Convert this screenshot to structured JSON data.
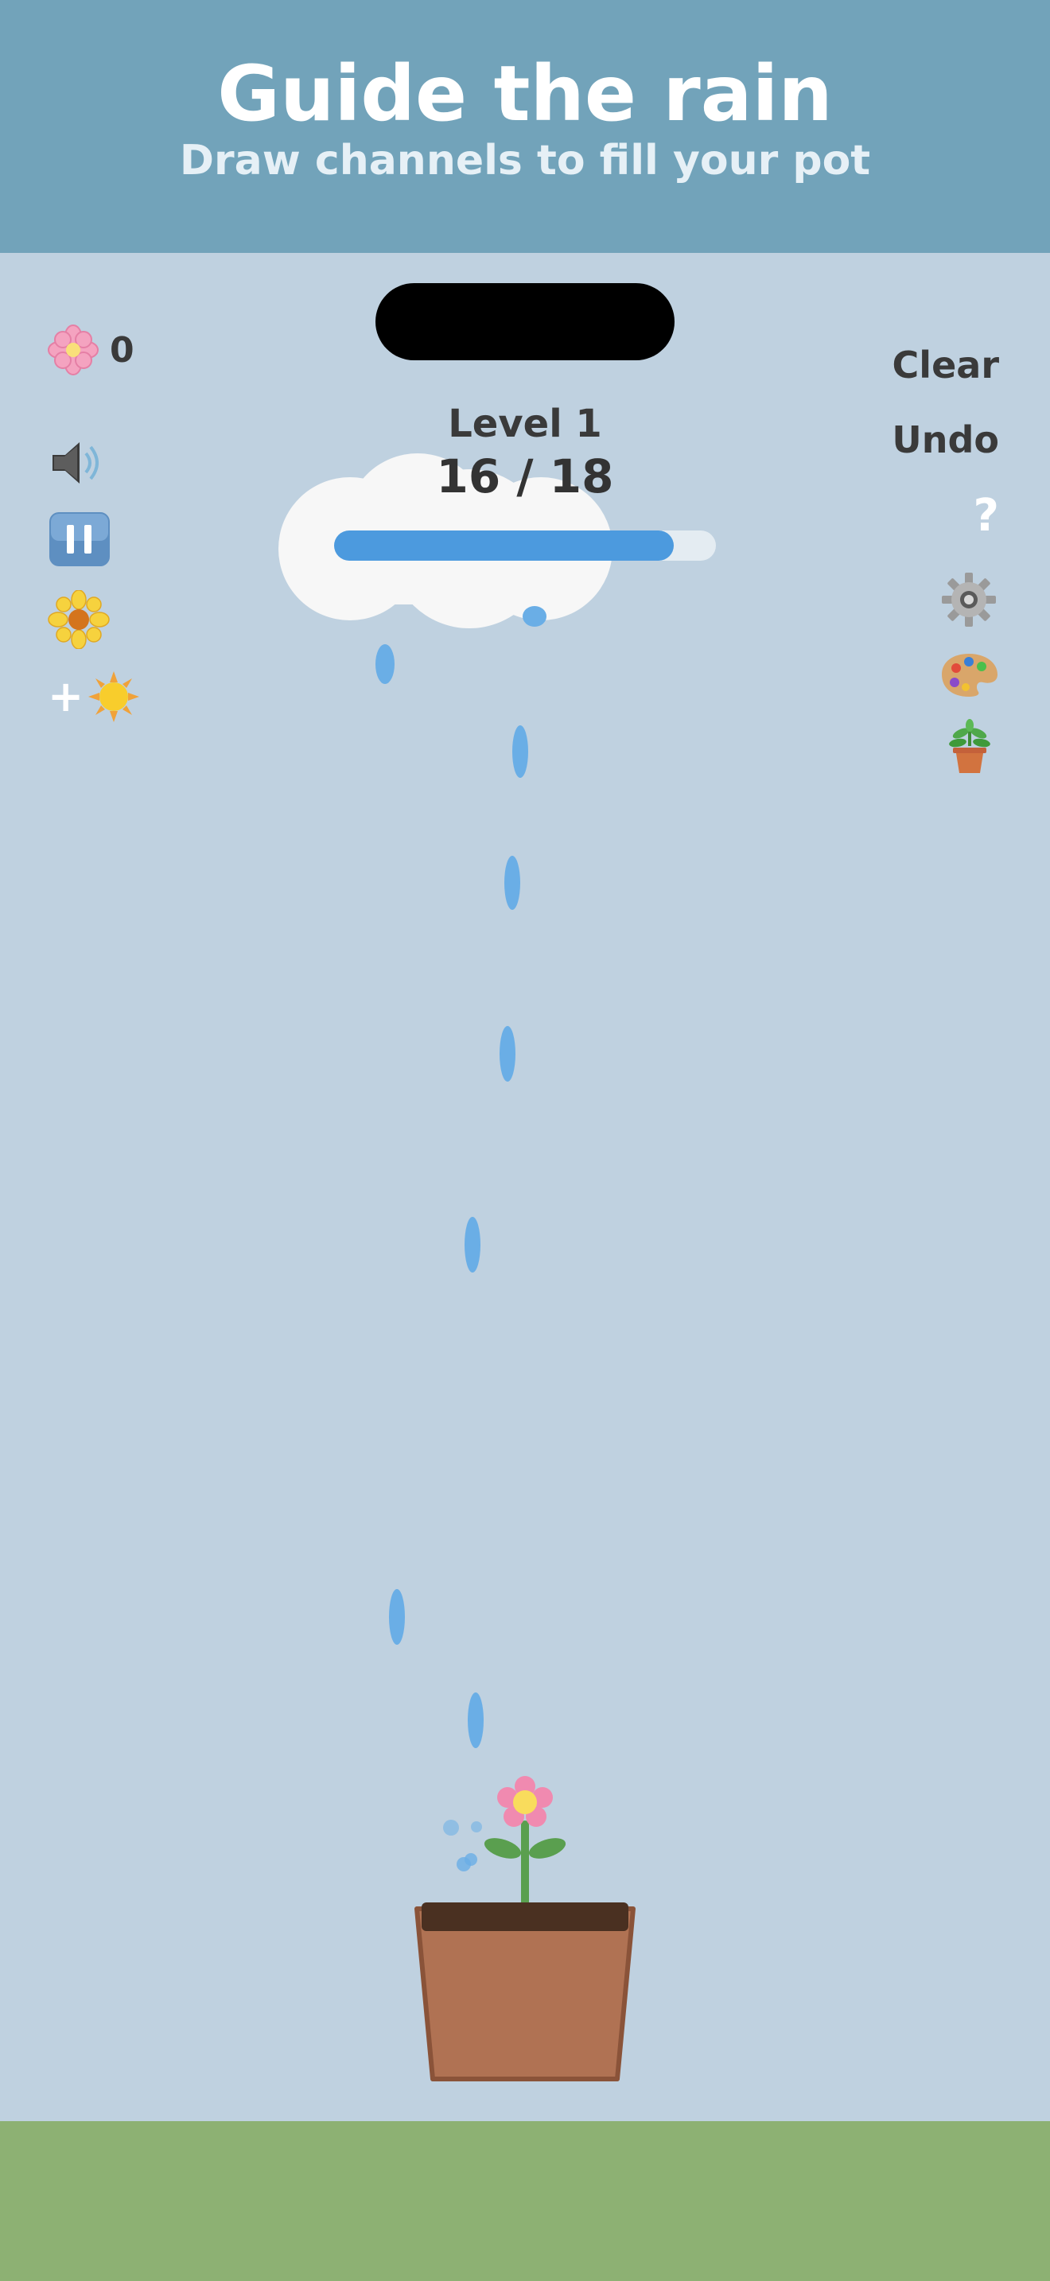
{
  "header": {
    "title": "Guide the rain",
    "subtitle": "Draw channels to fill your pot"
  },
  "hud": {
    "flower_count": "0",
    "level_label": "Level 1",
    "progress_text": "16 / 18",
    "progress_fraction": 0.889
  },
  "controls": {
    "clear_label": "Clear",
    "undo_label": "Undo",
    "help_label": "?",
    "sound_icon": "speaker-icon",
    "pause_icon": "pause-icon",
    "flower_icon": "sunflower-icon",
    "sun_boost_label": "+",
    "settings_icon": "gear-icon",
    "theme_icon": "palette-icon",
    "plant_icon": "potted-plant-icon"
  },
  "colors": {
    "header_bg": "#72a3ba",
    "sky_bg": "#bfd1e0",
    "ground": "#8db173",
    "water": "#6aaee6",
    "progress_fill": "#4c9ade",
    "pot": "#b07253"
  }
}
